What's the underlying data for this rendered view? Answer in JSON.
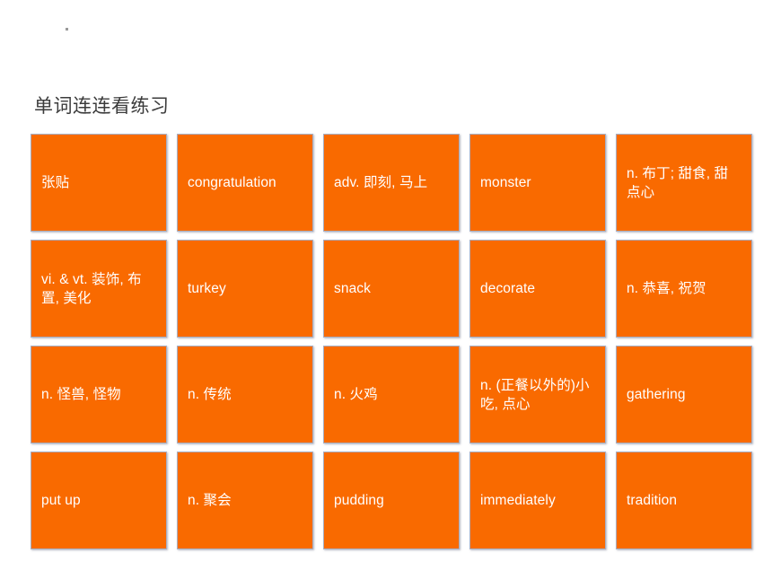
{
  "slide": {
    "title": "单词连连看练习",
    "decoration": {
      "dot": "."
    },
    "colors": {
      "card_fill": "#f96a00",
      "card_border": "#a8aec2",
      "card_text": "#ffffff",
      "title_text": "#3b3b3b",
      "background": "#ffffff"
    }
  },
  "grid": {
    "columns": 5,
    "rows": 4,
    "cards": [
      {
        "id": "card-1",
        "row": 1,
        "col": 1,
        "text": "张贴"
      },
      {
        "id": "card-2",
        "row": 1,
        "col": 2,
        "text": "congratulation"
      },
      {
        "id": "card-3",
        "row": 1,
        "col": 3,
        "text": "adv. 即刻, 马上"
      },
      {
        "id": "card-4",
        "row": 1,
        "col": 4,
        "text": "monster"
      },
      {
        "id": "card-5",
        "row": 1,
        "col": 5,
        "text": "n. 布丁; 甜食, 甜点心"
      },
      {
        "id": "card-6",
        "row": 2,
        "col": 1,
        "text": "vi. & vt. 装饰, 布置, 美化"
      },
      {
        "id": "card-7",
        "row": 2,
        "col": 2,
        "text": "turkey"
      },
      {
        "id": "card-8",
        "row": 2,
        "col": 3,
        "text": "snack"
      },
      {
        "id": "card-9",
        "row": 2,
        "col": 4,
        "text": "decorate"
      },
      {
        "id": "card-10",
        "row": 2,
        "col": 5,
        "text": "n. 恭喜, 祝贺"
      },
      {
        "id": "card-11",
        "row": 3,
        "col": 1,
        "text": "n. 怪兽, 怪物"
      },
      {
        "id": "card-12",
        "row": 3,
        "col": 2,
        "text": "n. 传统"
      },
      {
        "id": "card-13",
        "row": 3,
        "col": 3,
        "text": "n. 火鸡"
      },
      {
        "id": "card-14",
        "row": 3,
        "col": 4,
        "text": "n. (正餐以外的)小吃, 点心"
      },
      {
        "id": "card-15",
        "row": 3,
        "col": 5,
        "text": "gathering"
      },
      {
        "id": "card-16",
        "row": 4,
        "col": 1,
        "text": "put up"
      },
      {
        "id": "card-17",
        "row": 4,
        "col": 2,
        "text": "n. 聚会"
      },
      {
        "id": "card-18",
        "row": 4,
        "col": 3,
        "text": "pudding"
      },
      {
        "id": "card-19",
        "row": 4,
        "col": 4,
        "text": "immediately"
      },
      {
        "id": "card-20",
        "row": 4,
        "col": 5,
        "text": "tradition"
      }
    ]
  }
}
